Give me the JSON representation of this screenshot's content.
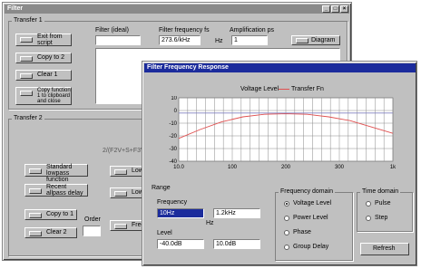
{
  "back_window": {
    "title": "Filter",
    "group1_title": "Transfer 1",
    "group2_title": "Transfer 2",
    "btn_exit": "Exit from script",
    "btn_copy2": "Copy to 2",
    "btn_clear1": "Clear 1",
    "btn_copy_fn": "Copy function 1 to clipboard and close",
    "col_filter_label": "Filter (ideal)",
    "col_freq_label": "Filter frequency fs",
    "col_freq_value": "273.6/kHz",
    "col_freq_unit": "Hz",
    "col_amp_label": "Amplification ps",
    "col_amp_value": "1",
    "btn_diagram": "Diagram",
    "formula": "2/(F2V+S+F3V+1)",
    "btn_std": "Standard lowpass function",
    "btn_allpass": "Recent allpass delay",
    "btn_copy1": "Copy to 1",
    "btn_clear2": "Clear 2",
    "order_label": "Order",
    "btn_low1": "Low",
    "btn_low2": "Low",
    "btn_freq": "Freq"
  },
  "front_window": {
    "title": "Filter Frequency Response",
    "legend_voltage": "Voltage Level",
    "legend_transfer": "Transfer Fn",
    "range_label": "Range",
    "freq_label": "Frequency",
    "freq_from": "10Hz",
    "freq_to": "1.2kHz",
    "hz_unit": "Hz",
    "level_label": "Level",
    "level_from": "-40.0dB",
    "level_to": "10.0dB",
    "freq_domain_title": "Frequency domain",
    "radio_voltage": "Voltage Level",
    "radio_power": "Power Level",
    "radio_phase": "Phase",
    "radio_group": "Group Delay",
    "time_domain_title": "Time domain",
    "radio_pulse": "Pulse",
    "radio_step": "Step",
    "btn_refresh": "Refresh"
  },
  "chart_data": {
    "type": "line",
    "ylim": [
      -40,
      10
    ],
    "yticks": [
      "10",
      "0",
      "-10",
      "-20",
      "-30",
      "-40"
    ],
    "xticks": [
      "10.0",
      "100",
      "200",
      "300",
      "1k"
    ],
    "series": [
      {
        "name": "Voltage Level",
        "color": "#e05050",
        "x": [
          0,
          0.1,
          0.2,
          0.3,
          0.4,
          0.5,
          0.6,
          0.7,
          0.8,
          0.9,
          1.0
        ],
        "y": [
          -22,
          -15,
          -9,
          -5,
          -3,
          -2.5,
          -3,
          -5,
          -8,
          -13,
          -18
        ]
      },
      {
        "name": "Transfer Fn",
        "color": "#8080c0",
        "x": [
          0,
          1.0
        ],
        "y": [
          -2,
          -2
        ]
      }
    ]
  }
}
